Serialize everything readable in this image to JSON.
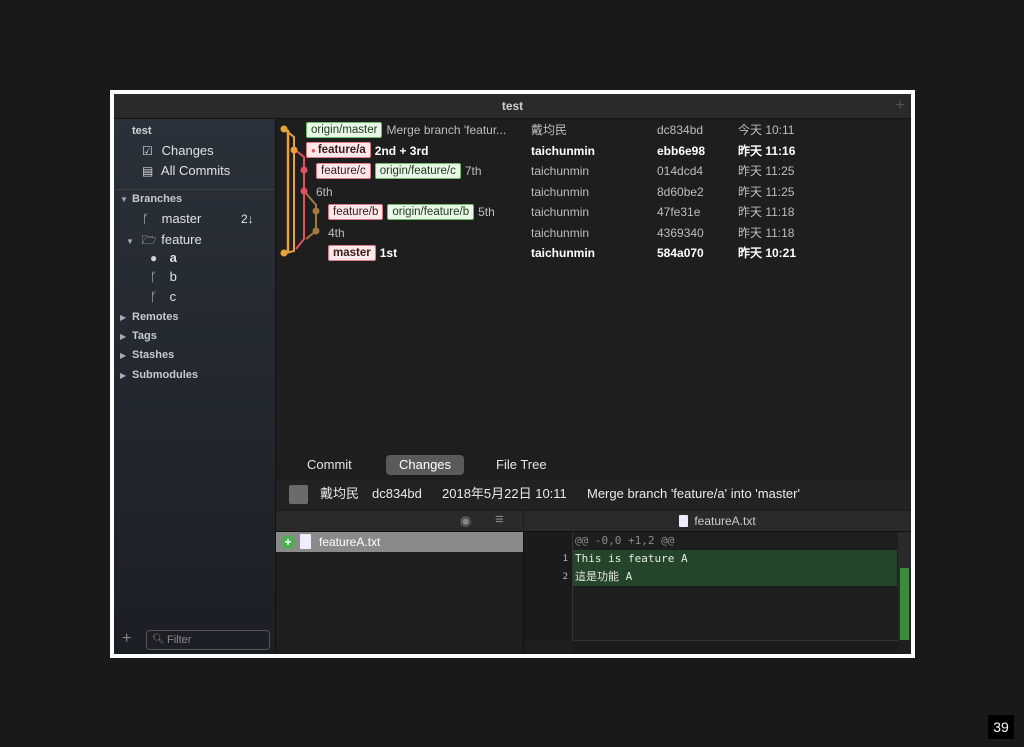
{
  "window": {
    "title": "test"
  },
  "sidebar": {
    "repo": "test",
    "nav": [
      {
        "label": "Changes",
        "icon": "edit-icon"
      },
      {
        "label": "All Commits",
        "icon": "drive-icon"
      }
    ],
    "sections": {
      "branches": "Branches",
      "remotes": "Remotes",
      "tags": "Tags",
      "stashes": "Stashes",
      "submodules": "Submodules"
    },
    "branches": {
      "master": {
        "label": "master",
        "badge": "2↓"
      },
      "folder": "feature",
      "children": [
        "a",
        "b",
        "c"
      ]
    },
    "filter_placeholder": "Filter"
  },
  "commits": [
    {
      "tags": [
        {
          "text": "origin/master",
          "kind": "green"
        }
      ],
      "message": "Merge branch 'featur...",
      "author": "戴均民",
      "hash": "dc834bd",
      "date": "今天 10:11",
      "bold": false
    },
    {
      "tags": [
        {
          "text": "feature/a",
          "kind": "red",
          "head": true
        }
      ],
      "message": "2nd + 3rd",
      "author": "taichunmin",
      "hash": "ebb6e98",
      "date": "昨天 11:16",
      "bold": true
    },
    {
      "tags": [
        {
          "text": "feature/c",
          "kind": "red"
        },
        {
          "text": "origin/feature/c",
          "kind": "green"
        }
      ],
      "message": "7th",
      "author": "taichunmin",
      "hash": "014dcd4",
      "date": "昨天 11:25",
      "bold": false
    },
    {
      "tags": [],
      "message": "6th",
      "author": "taichunmin",
      "hash": "8d60be2",
      "date": "昨天 11:25",
      "bold": false
    },
    {
      "tags": [
        {
          "text": "feature/b",
          "kind": "red"
        },
        {
          "text": "origin/feature/b",
          "kind": "green"
        }
      ],
      "message": "5th",
      "author": "taichunmin",
      "hash": "47fe31e",
      "date": "昨天 11:18",
      "bold": false
    },
    {
      "tags": [],
      "message": "4th",
      "author": "taichunmin",
      "hash": "4369340",
      "date": "昨天 11:18",
      "bold": false
    },
    {
      "tags": [
        {
          "text": "master",
          "kind": "red"
        }
      ],
      "message": "1st",
      "author": "taichunmin",
      "hash": "584a070",
      "date": "昨天 10:21",
      "bold": true
    }
  ],
  "tabs": [
    "Commit",
    "Changes",
    "File Tree"
  ],
  "active_tab": "Changes",
  "selected_commit": {
    "author": "戴均民",
    "hash": "dc834bd",
    "date": "2018年5月22日 10:11",
    "message": "Merge branch 'feature/a' into 'master'"
  },
  "files": [
    {
      "name": "featureA.txt",
      "status": "+"
    }
  ],
  "diff": {
    "file": "featureA.txt",
    "hunk": "@@ -0,0 +1,2 @@",
    "lines": [
      {
        "num": "1",
        "text": "This is feature A"
      },
      {
        "num": "2",
        "text": "這是功能 A"
      }
    ]
  },
  "page_number": "39",
  "colors": {
    "graph_orange": "#e8a23a",
    "graph_red": "#e0505e",
    "graph_brown": "#a07840",
    "add_green": "#25452a"
  }
}
